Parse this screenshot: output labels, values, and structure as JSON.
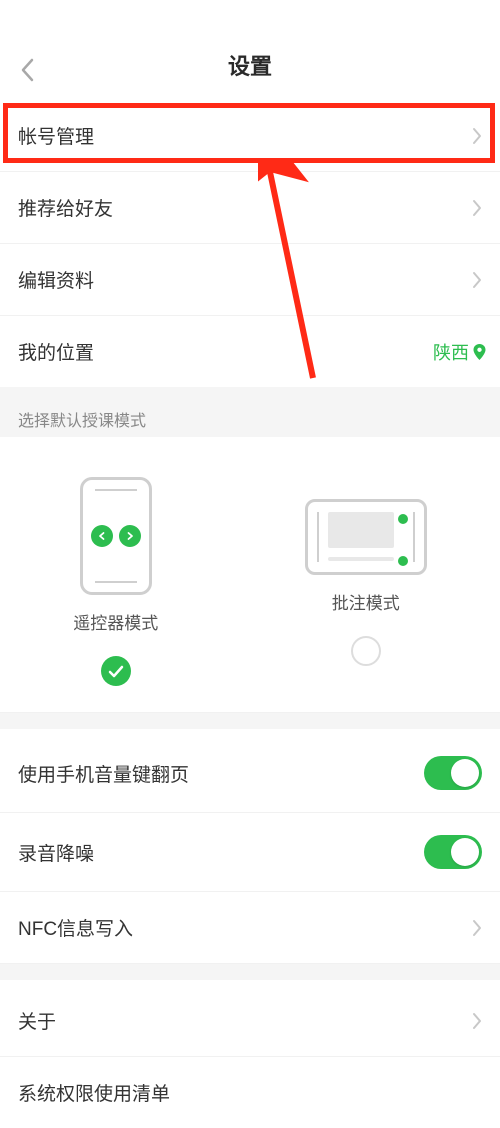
{
  "header": {
    "title": "设置"
  },
  "list1": {
    "account": "帐号管理",
    "recommend": "推荐给好友",
    "edit_profile": "编辑资料",
    "my_location": "我的位置",
    "location_value": "陕西"
  },
  "mode_section": {
    "label": "选择默认授课模式",
    "remote": "遥控器模式",
    "annotate": "批注模式",
    "selected": "remote"
  },
  "list2": {
    "volume_page": "使用手机音量键翻页",
    "noise_reduce": "录音降噪",
    "nfc": "NFC信息写入",
    "about": "关于",
    "permissions": "系统权限使用清单"
  },
  "toggles": {
    "volume_page": true,
    "noise_reduce": true
  },
  "annotation": {
    "highlighted_item": "帐号管理",
    "arrow_points_to": "帐号管理"
  }
}
